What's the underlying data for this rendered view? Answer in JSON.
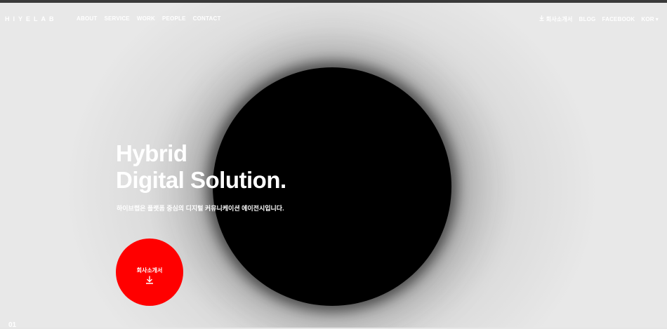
{
  "header": {
    "logo": "HIYELAB",
    "nav": [
      "ABOUT",
      "SERVICE",
      "WORK",
      "PEOPLE",
      "CONTACT"
    ],
    "util": {
      "company_intro": "회사소개서",
      "blog": "BLOG",
      "facebook": "FACEBOOK",
      "lang": "KOR"
    }
  },
  "hero": {
    "title_line1": "Hybrid",
    "title_line2": "Digital Solution.",
    "subtitle": "하이브랩은 플랫폼 중심의 디지털 커뮤니케이션 에이전시입니다.",
    "cta_label": "회사소개서"
  },
  "slide": {
    "number": "01"
  },
  "colors": {
    "accent": "#ff0000",
    "sphere": "#000000",
    "background": "#e6e6e6"
  }
}
